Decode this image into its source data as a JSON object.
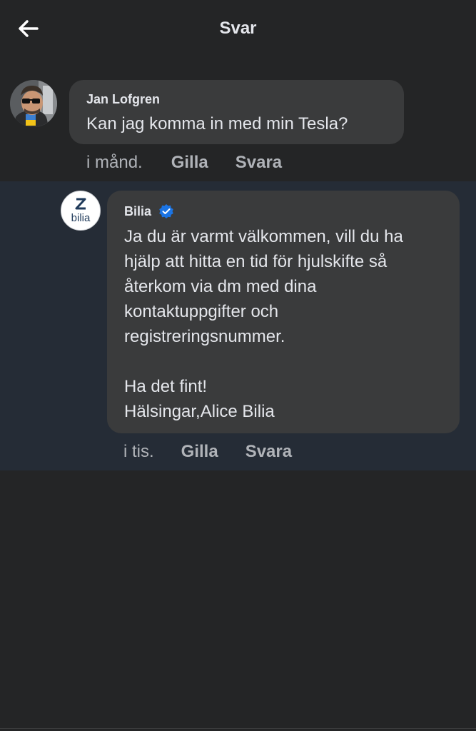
{
  "header": {
    "title": "Svar",
    "back_icon": "arrow-left-icon"
  },
  "comment": {
    "author": "Jan Lofgren",
    "text": "Kan jag komma in med min Tesla?",
    "time": "i månd.",
    "like_label": "Gilla",
    "reply_label": "Svara"
  },
  "reply": {
    "author": "Bilia",
    "verified": true,
    "verified_icon": "verified-badge-icon",
    "avatar_text": "bilia",
    "text": "Ja du är varmt välkommen, vill du ha\nhjälp att hitta en tid för hjulskifte så\nåterkom via dm med dina\nkontaktuppgifter och\nregistreringsnummer.\n\nHa det fint!\nHälsingar,Alice Bilia",
    "time": "i tis.",
    "like_label": "Gilla",
    "reply_label": "Svara"
  },
  "colors": {
    "background": "#242526",
    "bubble": "#3a3b3c",
    "highlight": "#252c36",
    "verified_blue": "#1b74e4",
    "muted_text": "#b0b3b8"
  }
}
